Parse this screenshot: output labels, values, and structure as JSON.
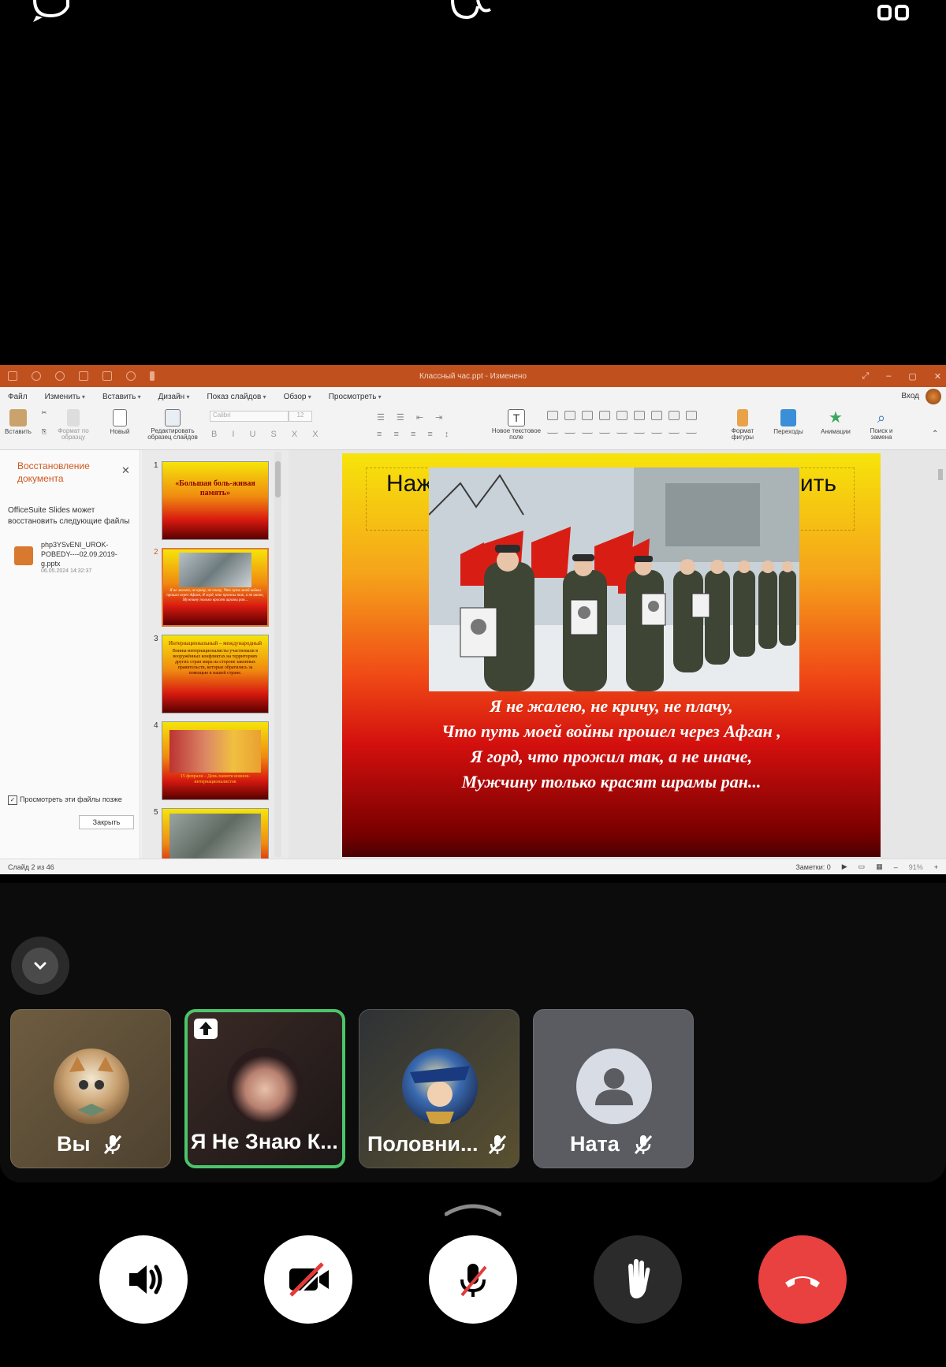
{
  "top_bar": {
    "chat_icon": "chat-bubble-icon",
    "center_icon": "participants-icon",
    "grid_icon": "grid-layout-icon"
  },
  "app": {
    "window_title": "Классный час.ppt - Изменено",
    "menu": [
      "Файл",
      "Изменить",
      "Вставить",
      "Дизайн",
      "Показ слайдов",
      "Обзор",
      "Просмотреть"
    ],
    "login": "Вход",
    "ribbon": {
      "paste": "Вставить",
      "format_painter": "Формат по образцу",
      "new": "Новый",
      "edit_master": "Редактировать образец слайдов",
      "font": "Calibri",
      "font_size": "12",
      "new_textbox": "Новое текстовое поле",
      "shape_format": "Формат фигуры",
      "transitions": "Переходы",
      "animations": "Анимации",
      "find_replace": "Поиск и замена"
    },
    "recovery": {
      "title": "Восстановление документа",
      "text": "OfficeSuite Slides может восстановить следующие файлы",
      "file_name": "php3YSvENI_UROK-POBEDY----02.09.2019-g.pptx",
      "file_date": "06.05.2024 14:32:37",
      "check_label": "Просмотреть эти файлы позже",
      "close_button": "Закрыть"
    },
    "thumbnails": [
      {
        "num": "1",
        "text": "«Большая боль-живая память»"
      },
      {
        "num": "2",
        "text": "Я не жалею, не кричу, не плачу, Что путь моей войны прошел через Афган, Я горд, что прожил так, а не иначе, Мужчину только красят шрамы ран..."
      },
      {
        "num": "3",
        "title": "Интернациональный – международный",
        "text": "Воины-интернационалисты участвовали в вооружённых конфликтах на территориях других стран мира на стороне законных правительств, которые обратились за помощью к нашей стране."
      },
      {
        "num": "4",
        "text": "15 февраля – День памяти воинов-интернационалистов"
      },
      {
        "num": "5"
      }
    ],
    "slide": {
      "title_left": "Наж",
      "title_right": "ить",
      "poem": [
        "Я не жалею, не кричу, не плачу,",
        "Что путь моей войны прошел через Афган ,",
        "Я горд, что прожил так, а не иначе,",
        "Мужчину только красят шрамы ран..."
      ]
    },
    "status": {
      "slide_counter": "Слайд 2 из 46",
      "notes": "Заметки: 0",
      "zoom": "91%"
    }
  },
  "participants": [
    {
      "name": "Вы",
      "muted": true,
      "avatar": "cat-cartoon-avatar"
    },
    {
      "name": "Я Не Знаю К...",
      "muted": false,
      "speaking": true,
      "sharing": true,
      "avatar": "woman-photo-avatar"
    },
    {
      "name": "Половни...",
      "muted": true,
      "avatar": "anime-character-avatar"
    },
    {
      "name": "Ната",
      "muted": true,
      "avatar": "default-person-avatar"
    }
  ],
  "controls": [
    "speaker-icon",
    "camera-off-icon",
    "mic-off-icon",
    "raise-hand-icon",
    "end-call-icon"
  ],
  "colors": {
    "speaking_border": "#4cc56a",
    "end_call": "#e94040",
    "accent_orange": "#c0511f"
  }
}
